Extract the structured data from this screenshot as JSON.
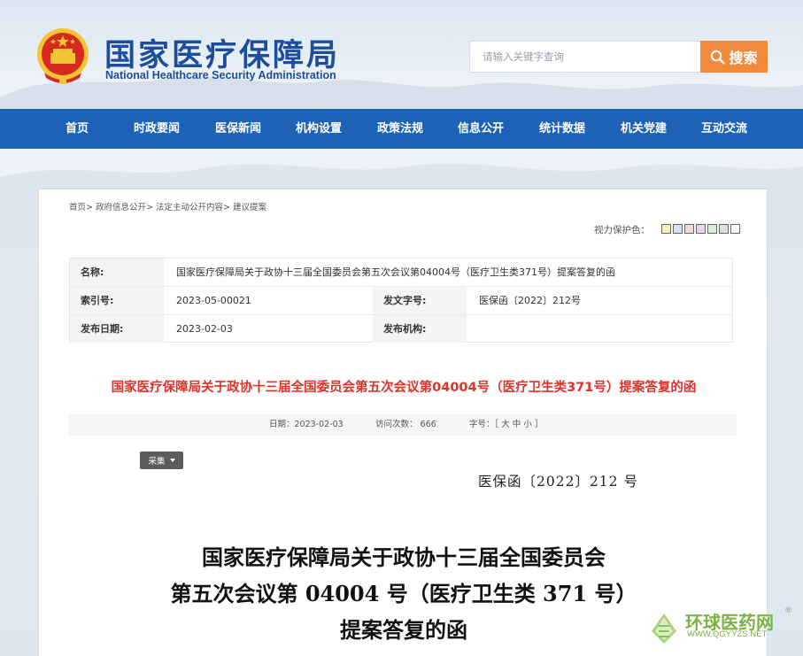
{
  "header": {
    "site_title": "国家医疗保障局",
    "site_subtitle": "National Healthcare Security Administration",
    "search_placeholder": "请输入关键字查询",
    "search_button": "搜索"
  },
  "nav": [
    "首页",
    "时政要闻",
    "医保新闻",
    "机构设置",
    "政策法规",
    "信息公开",
    "统计数据",
    "机关党建",
    "互动交流"
  ],
  "breadcrumb": [
    "首页",
    "政府信息公开",
    "法定主动公开内容",
    "建议提案"
  ],
  "breadcrumb_sep": ">",
  "eye_protect_label": "视力保护色：",
  "eye_colors": [
    "#f6f0b8",
    "#cfe3f5",
    "#f4d7d9",
    "#e7d3ee",
    "#d8eed3",
    "#dddddd",
    "#ffffff"
  ],
  "meta": {
    "name_label": "名称:",
    "name_value": "国家医疗保障局关于政协十三届全国委员会第五次会议第04004号（医疗卫生类371号）提案答复的函",
    "index_label": "索引号:",
    "index_value": "2023-05-00021",
    "docno_label": "发文字号:",
    "docno_value": "医保函〔2022〕212号",
    "date_label": "发布日期:",
    "date_value": "2023-02-03",
    "org_label": "发布机构:",
    "org_value": ""
  },
  "doc_title": "国家医疗保障局关于政协十三届全国委员会第五次会议第04004号（医疗卫生类371号）提案答复的函",
  "info_bar": {
    "date": "日期：2023-02-03",
    "visits": "访问次数：  666",
    "font_size": "字号：［ 大 中 小 ］"
  },
  "collect_button": "采集",
  "document": {
    "number": "医保函〔2022〕212 号",
    "title_line1": "国家医疗保障局关于政协十三届全国委员会",
    "title_line2": "第五次会议第 04004 号（医疗卫生类 371 号）",
    "title_line3": "提案答复的函"
  },
  "watermark": {
    "text": "环球医药网",
    "url": "WWW.QGYYZS.NET",
    "mark": "®"
  },
  "colors": {
    "nav_bg": "#1e62b8",
    "title_blue": "#1d4e9e",
    "search_btn": "#f08a3c",
    "doc_title_red": "#e0312b"
  }
}
